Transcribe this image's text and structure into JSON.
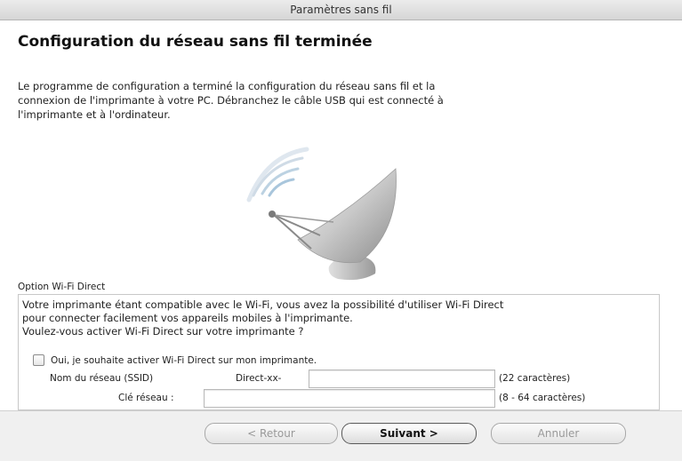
{
  "window": {
    "title": "Paramètres sans fil"
  },
  "heading": "Configuration du réseau sans fil terminée",
  "body": {
    "line1": "Le programme de configuration a terminé la configuration du réseau sans fil et la",
    "line2": "connexion de l'imprimante à votre PC. Débranchez le câble USB qui est connecté à",
    "line3": "l'imprimante et à l'ordinateur."
  },
  "wifi_direct": {
    "section_label": "Option Wi-Fi Direct",
    "desc_line1": "Votre imprimante étant compatible avec le Wi-Fi, vous avez la possibilité d'utiliser Wi-Fi Direct",
    "desc_line2": "pour connecter facilement vos appareils mobiles à l'imprimante.",
    "desc_line3": "Voulez-vous activer Wi-Fi Direct sur votre imprimante ?",
    "checkbox_label": "Oui, je souhaite activer Wi-Fi Direct sur mon imprimante.",
    "checkbox_checked": false,
    "ssid_label": "Nom du réseau (SSID)",
    "ssid_prefix": "Direct-xx-",
    "ssid_value": "",
    "ssid_hint": "(22 caractères)",
    "key_label": "Clé réseau :",
    "key_value": "",
    "key_hint": "(8 - 64 caractères)"
  },
  "buttons": {
    "back": "< Retour",
    "next": "Suivant >",
    "cancel": "Annuler"
  },
  "icons": {
    "illustration": "satellite-dish-icon",
    "checkbox": "checkbox-icon"
  }
}
